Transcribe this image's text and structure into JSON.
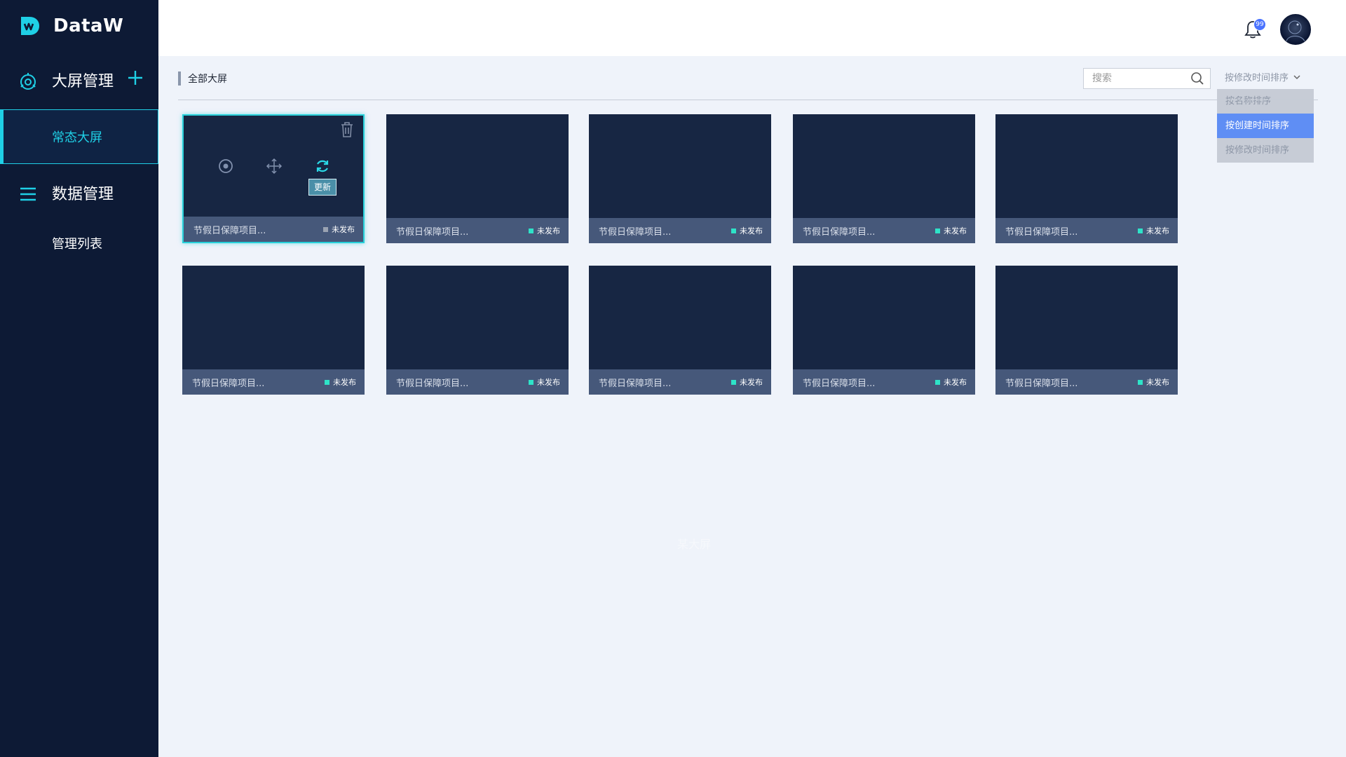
{
  "app": {
    "name": "DataW"
  },
  "colors": {
    "sidebar": "#0d1a35",
    "accent": "#1fd0e6",
    "card": "#172643",
    "card_footer": "#46587a",
    "status_dot": "#2ee3c8",
    "sort_selected": "#5f8ef4"
  },
  "sidebar": {
    "group1": {
      "label": "大屏管理",
      "icon": "screen-target-icon",
      "action_icon": "plus-icon"
    },
    "group1_items": [
      {
        "label": "常态大屏",
        "active": true
      }
    ],
    "group2": {
      "label": "数据管理",
      "icon": "list-menu-icon"
    },
    "group2_items": [
      {
        "label": "管理列表",
        "active": false
      }
    ]
  },
  "header": {
    "notifications": {
      "icon": "bell-icon",
      "count": "99"
    },
    "avatar": "user-avatar"
  },
  "content": {
    "section_title": "全部大屏",
    "search": {
      "placeholder": "搜索",
      "icon": "search-icon"
    },
    "sort": {
      "current": "按修改时间排序",
      "options": [
        "按名称排序",
        "按创建时间排序",
        "按修改时间排序"
      ],
      "selected_index": 1
    },
    "hover_card": {
      "tooltip": "更新",
      "icons": [
        "eye-icon",
        "move-icon",
        "refresh-icon",
        "trash-icon"
      ]
    },
    "cards": [
      {
        "name": "节假日保障项目...",
        "status": "未发布"
      },
      {
        "name": "节假日保障项目...",
        "status": "未发布"
      },
      {
        "name": "节假日保障项目...",
        "status": "未发布"
      },
      {
        "name": "节假日保障项目...",
        "status": "未发布"
      },
      {
        "name": "节假日保障项目...",
        "status": "未发布"
      },
      {
        "name": "节假日保障项目...",
        "status": "未发布"
      },
      {
        "name": "节假日保障项目...",
        "status": "未发布"
      },
      {
        "name": "节假日保障项目...",
        "status": "未发布"
      },
      {
        "name": "节假日保障项目...",
        "status": "未发布"
      },
      {
        "name": "节假日保障项目...",
        "status": "未发布"
      }
    ],
    "watermark": "某大屏"
  }
}
